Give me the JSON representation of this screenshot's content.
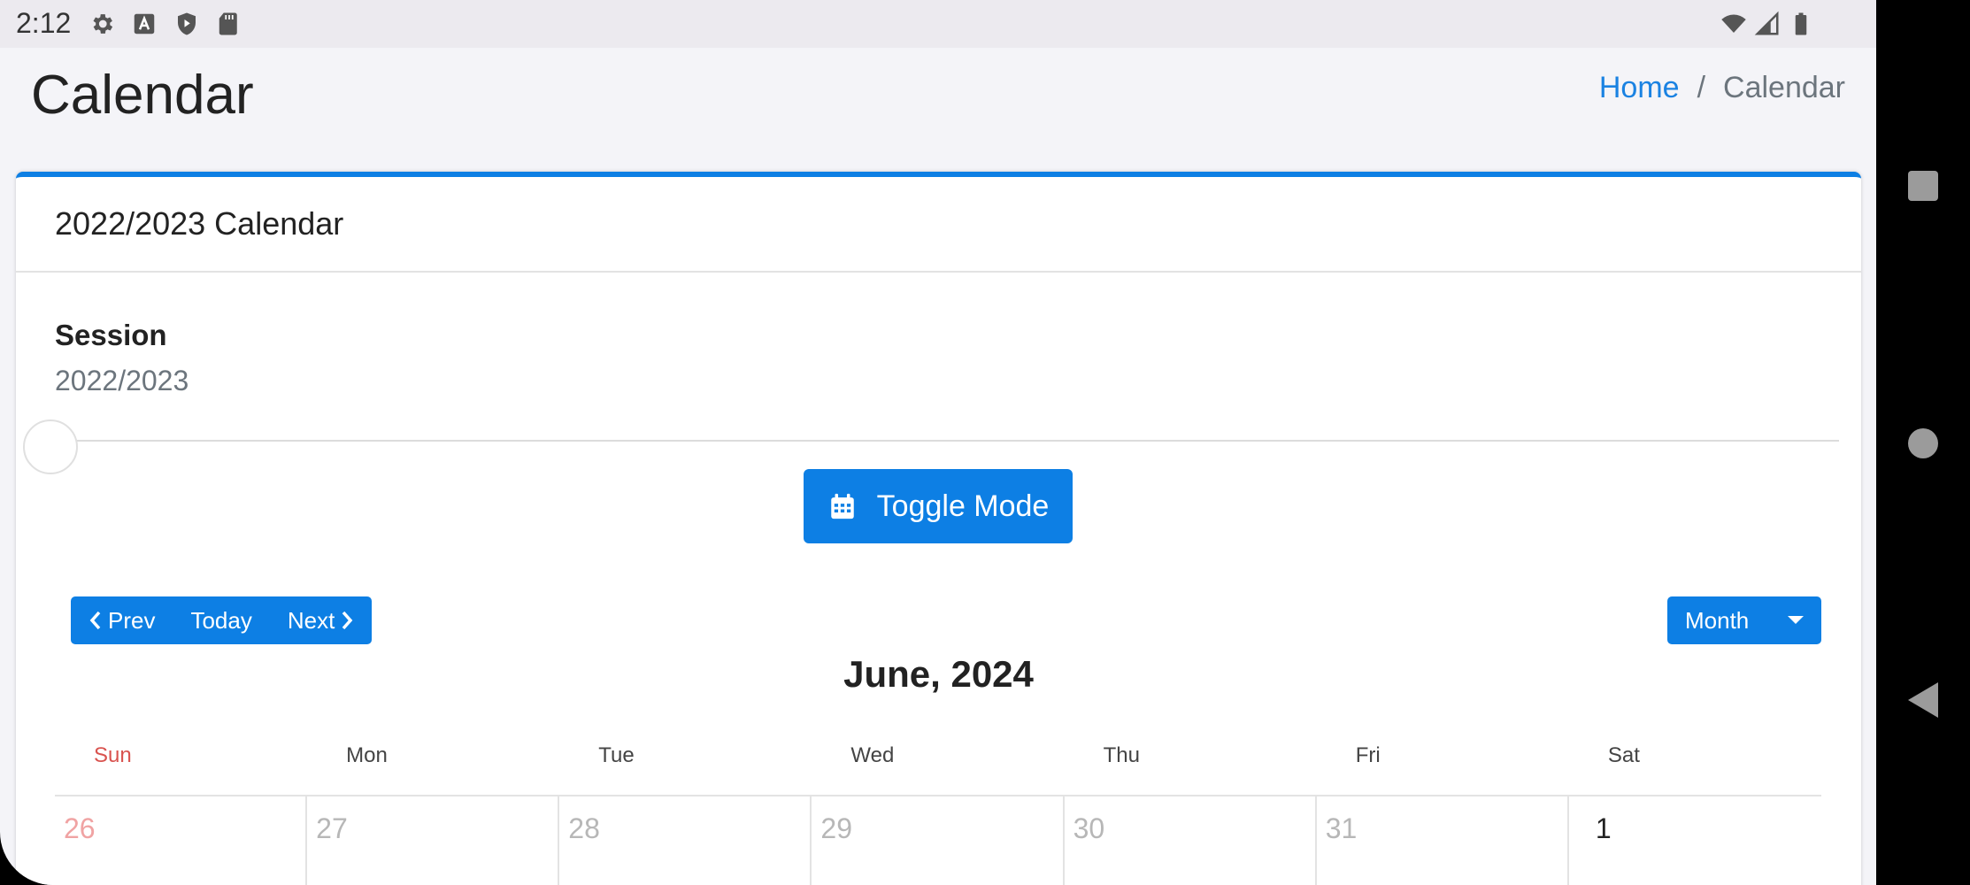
{
  "status_bar": {
    "time": "2:12"
  },
  "header": {
    "title": "Calendar",
    "breadcrumb": [
      "Home",
      "/",
      "Calendar"
    ]
  },
  "card": {
    "title": "2022/2023 Calendar",
    "session_label": "Session",
    "session_value": "2022/2023",
    "toggle_label": "Toggle Mode",
    "nav": {
      "prev": "Prev",
      "today": "Today",
      "next": "Next"
    },
    "view": "Month",
    "month_title": "June, 2024",
    "weekdays": [
      "Sun",
      "Mon",
      "Tue",
      "Wed",
      "Thu",
      "Fri",
      "Sat"
    ],
    "days": [
      "26",
      "27",
      "28",
      "29",
      "30",
      "31",
      "1"
    ]
  },
  "colors": {
    "accent": "#0d7fe4",
    "sunday": "#d9534f",
    "link": "#1a82e2"
  }
}
